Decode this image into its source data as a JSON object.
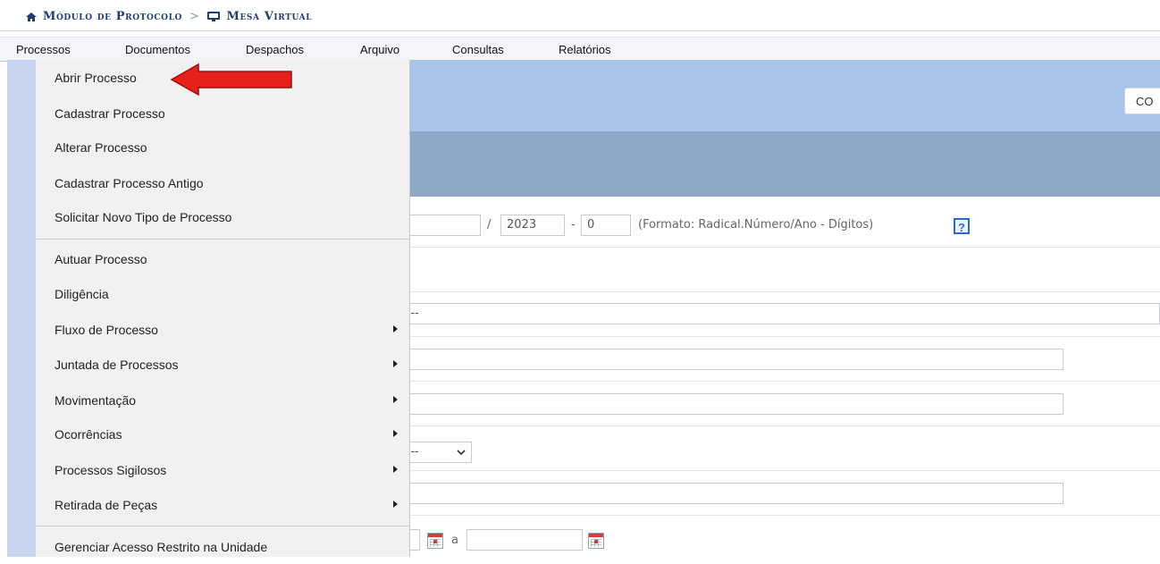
{
  "breadcrumb": {
    "module": "Módulo de Protocolo",
    "separator": ">",
    "page": "Mesa Virtual"
  },
  "menubar": {
    "items": [
      "Processos",
      "Documentos",
      "Despachos",
      "Arquivo",
      "Consultas",
      "Relatórios"
    ]
  },
  "dropdown": {
    "items": [
      {
        "label": "Abrir Processo"
      },
      {
        "label": "Cadastrar Processo"
      },
      {
        "label": "Alterar Processo"
      },
      {
        "label": "Cadastrar Processo Antigo"
      },
      {
        "label": "Solicitar Novo Tipo de Processo"
      },
      {
        "label": "Autuar Processo"
      },
      {
        "label": "Diligência"
      },
      {
        "label": "Fluxo de Processo",
        "has_submenu": true
      },
      {
        "label": "Juntada de Processos",
        "has_submenu": true
      },
      {
        "label": "Movimentação",
        "has_submenu": true
      },
      {
        "label": "Ocorrências",
        "has_submenu": true
      },
      {
        "label": "Processos Sigilosos",
        "has_submenu": true
      },
      {
        "label": "Retirada de Peças",
        "has_submenu": true
      },
      {
        "label": "Gerenciar Acesso Restrito na Unidade"
      }
    ]
  },
  "form": {
    "co_button": "CO",
    "slash": "/",
    "year": "2023",
    "dash": "-",
    "digit": "0",
    "format_hint": "(Formato: Radical.Número/Ano - Dígitos)",
    "help": "?",
    "select1_text": "E --",
    "select2_text": "E --",
    "range_sep": "a"
  },
  "colors": {
    "annotation_arrow": "#e8201c",
    "header_band": "#a9c4ea",
    "section_band": "#8ea8c8"
  }
}
